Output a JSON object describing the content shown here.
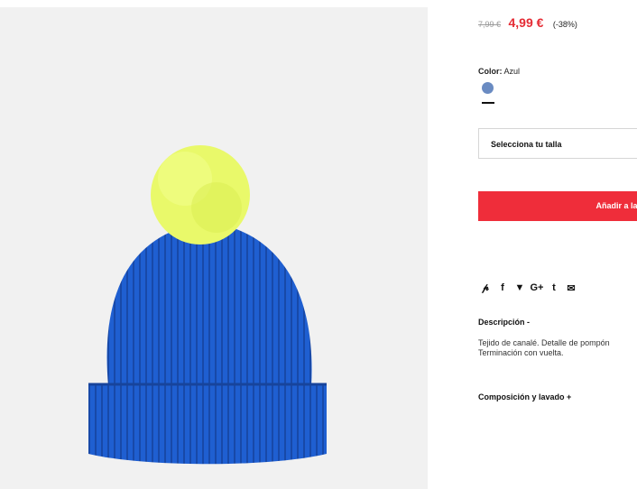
{
  "product": {
    "image_alt": "beanie-with-pompom",
    "old_price": "7,99 €",
    "price": "4,99 €",
    "discount": "(-38%)",
    "color_label": "Color:",
    "color_value": "Azul",
    "swatch_color": "#6a8bc2",
    "size_select_label": "Selecciona tu talla",
    "add_to_bag_label": "Añadir a la bo",
    "share_icons": [
      "pinterest-icon",
      "facebook-icon",
      "twitter-icon",
      "google-plus-icon",
      "tumblr-icon",
      "email-icon"
    ],
    "description_title": "Descripción -",
    "description_text_line1": "Tejido de canalé. Detalle de pompón",
    "description_text_line2": "Terminación con vuelta.",
    "composition_title": "Composición y lavado +"
  },
  "colors": {
    "accent": "#ef2d3a",
    "price_red": "#e52b34",
    "hat_blue": "#1f5fd1",
    "pompom": "#eafa6a"
  }
}
